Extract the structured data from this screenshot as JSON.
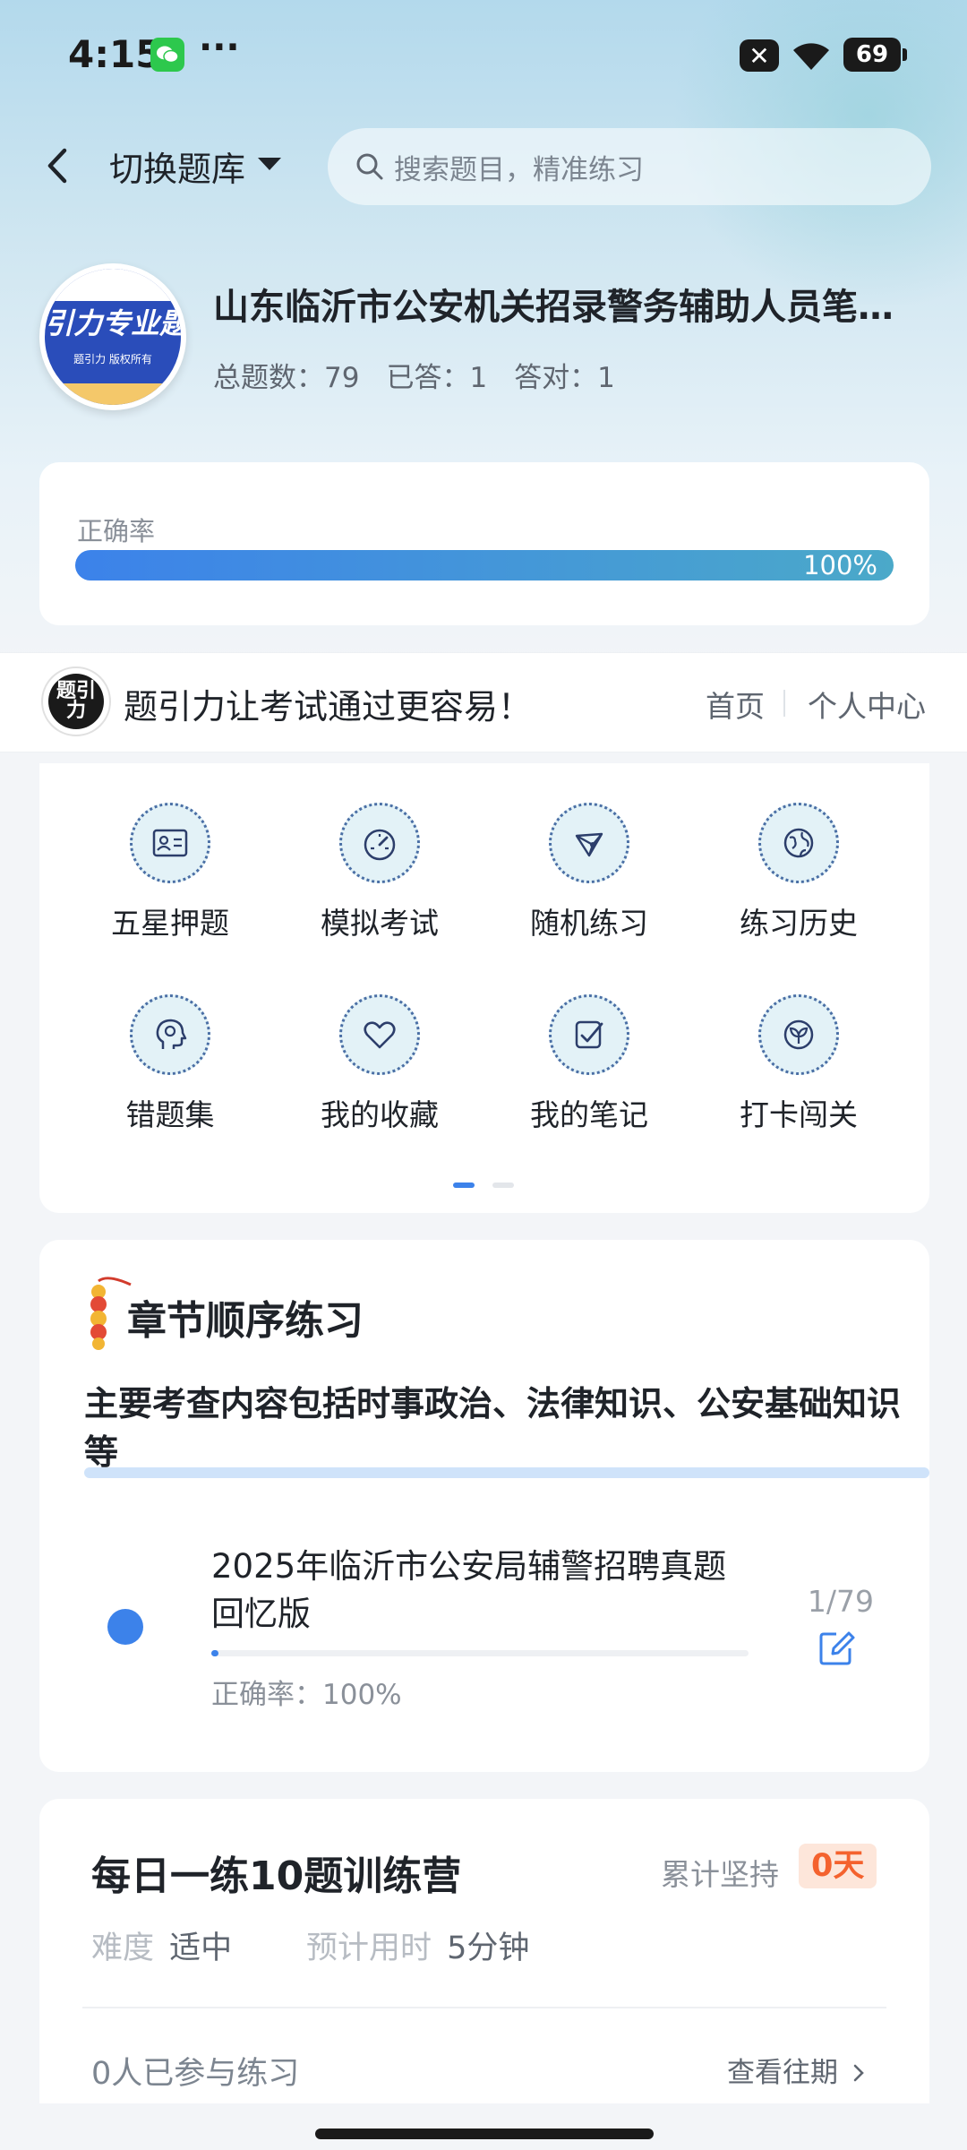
{
  "status_bar": {
    "time": "4:15",
    "more": "···",
    "battery": "69"
  },
  "header": {
    "switch_label": "切换题库",
    "search_placeholder": "搜索题目，精准练习"
  },
  "book": {
    "title": "山东临沂市公安机关招录警务辅助人员笔试真题",
    "cover_text": "引力专业题",
    "cover_small": "题引力 版权所有",
    "stats": [
      "总题数：79",
      "已答：1",
      "答对：1"
    ]
  },
  "accuracy": {
    "label": "正确率",
    "value_text": "100%",
    "value": 1.0
  },
  "banner": {
    "logo_text": "题引力",
    "slogan": "题引力让考试通过更容易！",
    "home": "首页",
    "me": "个人中心"
  },
  "grid": {
    "items": [
      {
        "label": "五星押题",
        "icon": "id-card-icon"
      },
      {
        "label": "模拟考试",
        "icon": "speedometer-icon"
      },
      {
        "label": "随机练习",
        "icon": "network-icon"
      },
      {
        "label": "练习历史",
        "icon": "globe-icon"
      },
      {
        "label": "错题集",
        "icon": "head-icon"
      },
      {
        "label": "我的收藏",
        "icon": "heart-icon"
      },
      {
        "label": "我的笔记",
        "icon": "note-check-icon"
      },
      {
        "label": "打卡闯关",
        "icon": "sprout-icon"
      }
    ],
    "page": 1,
    "pages": 2
  },
  "chapter": {
    "title": "章节顺序练习",
    "description": "主要考查内容包括时事政治、法律知识、公安基础知识等",
    "item": {
      "title": "2025年临沂市公安局辅警招聘真题回忆版",
      "count": "1/79",
      "progress": 0.0127,
      "accuracy": "正确率：100%"
    }
  },
  "daily": {
    "title": "每日一练10题训练营",
    "streak_label": "累计坚持",
    "streak_value": "0天",
    "difficulty_label": "难度",
    "difficulty_value": "适中",
    "time_label": "预计用时",
    "time_value": "5分钟",
    "joined": "0人已参与练习",
    "history": "查看往期"
  },
  "colors": {
    "accent": "#3c82ea",
    "teal": "#4ba9c9",
    "streak": "#f4622e"
  }
}
